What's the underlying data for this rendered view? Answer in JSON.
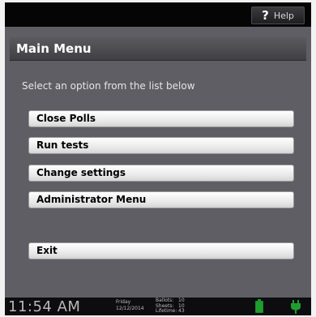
{
  "help": {
    "icon": "question-icon",
    "label": "Help"
  },
  "title": "Main Menu",
  "instruction": "Select an option from the list below",
  "menu": {
    "close_polls": "Close Polls",
    "run_tests": "Run tests",
    "change_settings": "Change settings",
    "administrator_menu": "Administrator Menu",
    "exit": "Exit"
  },
  "status": {
    "time": "11:54 AM",
    "day": "Friday",
    "date": "12/12/2014",
    "ballots_label": "Ballots:",
    "ballots_value": "10",
    "sheets_label": "Sheets:",
    "sheets_value": "10",
    "lifetime_label": "Lifetime:",
    "lifetime_value": "43",
    "battery_icon": "battery-full-icon",
    "power_icon": "power-plug-icon",
    "status_color": "#1f9e2f"
  }
}
